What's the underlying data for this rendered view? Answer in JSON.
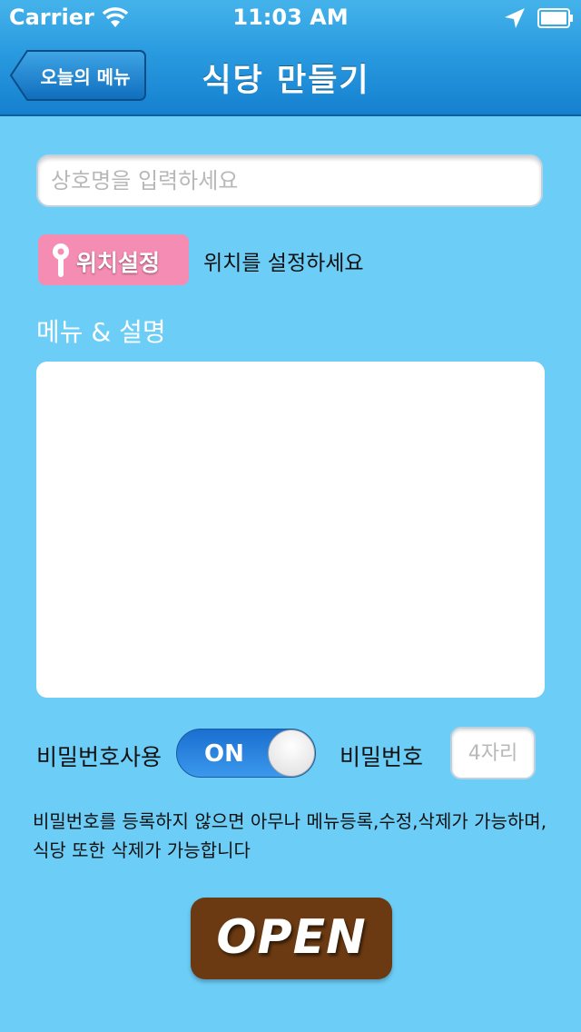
{
  "status_bar": {
    "carrier": "Carrier",
    "time": "11:03 AM",
    "icons": [
      "wifi-icon",
      "location-arrow-icon",
      "battery-icon"
    ]
  },
  "nav": {
    "back_label": "오늘의 메뉴",
    "title": "식당 만들기"
  },
  "form": {
    "name_placeholder": "상호명을 입력하세요",
    "name_value": "",
    "location_button_label": "위치설정",
    "location_hint": "위치를 설정하세요",
    "menu_label": "메뉴 & 설명",
    "menu_value": "",
    "password_use_label": "비밀번호사용",
    "password_toggle_state": "ON",
    "password_label": "비밀번호",
    "password_placeholder": "4자리",
    "notice": "비밀번호를 등록하지 않으면 아무나 메뉴등록,수정,삭제가 가능하며, 식당 또한 삭제가 가능합니다",
    "open_label": "OPEN"
  },
  "colors": {
    "background": "#6ccdf7",
    "nav_bar": "#2a9be0",
    "location_button": "#f58cb4",
    "toggle_on": "#1a6fd0",
    "open_button": "#6b3a12"
  }
}
